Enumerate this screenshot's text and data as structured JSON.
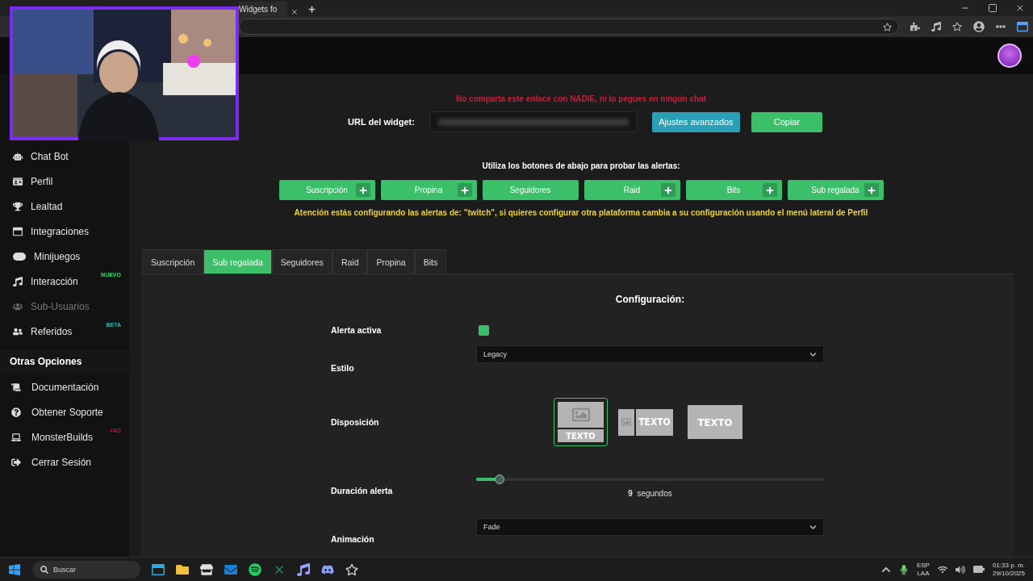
{
  "browser": {
    "tab_title": "Widgets fo"
  },
  "sidebar": {
    "items": [
      {
        "label": "Chat Bot",
        "disabled": false
      },
      {
        "label": "Perfil",
        "disabled": false
      },
      {
        "label": "Lealtad",
        "disabled": false
      },
      {
        "label": "Integraciones",
        "disabled": false
      },
      {
        "label": "Minijuegos",
        "disabled": false
      },
      {
        "label": "Interacción",
        "disabled": false,
        "badge": "NUEVO",
        "color": "#3ddc7a"
      },
      {
        "label": "Sub-Usuarios",
        "disabled": true
      },
      {
        "label": "Referidos",
        "disabled": false,
        "badge": "BETA",
        "color": "#2bb3b3"
      }
    ],
    "section_title": "Otras Opciones",
    "other_items": [
      {
        "label": "Documentación"
      },
      {
        "label": "Obtener Soporte"
      },
      {
        "label": "MonsterBuilds",
        "badge": "#AD",
        "color": "#a3203c"
      },
      {
        "label": "Cerrar Sesión"
      }
    ]
  },
  "main": {
    "warning": "No comparta este enlace con NADIE, ni lo pegues en ningún chat",
    "url_label": "URL del widget:",
    "buttons": [
      {
        "kind": "info",
        "label": "Ajustes avanzados"
      },
      {
        "kind": "success",
        "label": "Copiar"
      }
    ],
    "test_prompt": "Utiliza los botones de abajo para probar las alertas:",
    "test_buttons": [
      {
        "label": "Suscripción",
        "plus": true
      },
      {
        "label": "Propina",
        "plus": true
      },
      {
        "label": "Seguidores",
        "plus": false
      },
      {
        "label": "Raid",
        "plus": true
      },
      {
        "label": "Bits",
        "plus": true
      },
      {
        "label": "Sub regalada",
        "plus": true
      }
    ],
    "notice": "Atención estás configurando las alertas de: \"twitch\", si quieres configurar otra plataforma cambia a su configuración usando el menú lateral de Perfil",
    "tabs": [
      {
        "label": "Suscripción",
        "selected": false
      },
      {
        "label": "Sub regalada",
        "selected": true
      },
      {
        "label": "Seguidores",
        "selected": false
      },
      {
        "label": "Raid",
        "selected": false
      },
      {
        "label": "Propina",
        "selected": false
      },
      {
        "label": "Bits",
        "selected": false
      }
    ],
    "config": {
      "title": "Configuración:",
      "fields": [
        {
          "kind": "checkbox",
          "label": "Alerta activa",
          "checked": true
        },
        {
          "kind": "select",
          "label": "Estilo",
          "value": "Legacy"
        },
        {
          "kind": "layout",
          "label": "Disposición",
          "options": [
            {
              "kind": "stacked",
              "caption": "TEXTO",
              "selected": true
            },
            {
              "kind": "side",
              "caption": "TEXTO",
              "selected": false
            },
            {
              "kind": "overlay",
              "caption": "TEXTO",
              "selected": false
            }
          ]
        },
        {
          "kind": "slider",
          "label": "Duración alerta",
          "level": 0.067,
          "value": "9",
          "unit": "segundos"
        },
        {
          "kind": "select",
          "label": "Animación",
          "value": "Fade"
        }
      ]
    }
  },
  "taskbar": {
    "search_placeholder": "Buscar",
    "language": "ESP",
    "layout": "LAA",
    "time": "01:33 p. m.",
    "date": "29/10/2025"
  }
}
